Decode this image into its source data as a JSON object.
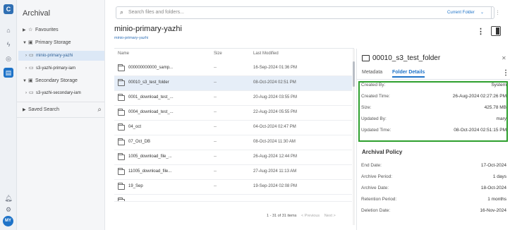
{
  "app": {
    "nav_title": "Archival",
    "avatar_initials": "MY"
  },
  "nav": {
    "favourites": "Favourites",
    "primary_storage": "Primary Storage",
    "primary_buckets": [
      "minio-primary-yazhi",
      "s3-yazhi-primary-iam"
    ],
    "secondary_storage": "Secondary Storage",
    "secondary_buckets": [
      "s3-yazhi-secondary-iam"
    ],
    "saved_search": "Saved Search"
  },
  "search": {
    "placeholder": "Search files and folders...",
    "scope": "Current Folder"
  },
  "bucket": {
    "title": "minio-primary-yazhi",
    "subtitle": "minio-primary-yazhi"
  },
  "table": {
    "columns": {
      "name": "Name",
      "size": "Size",
      "modified": "Last Modified"
    },
    "rows": [
      {
        "name": "000000000000_samp...",
        "size": "--",
        "modified": "16-Sep-2024 01:36 PM"
      },
      {
        "name": "00010_s3_test_folder",
        "size": "--",
        "modified": "08-Oct-2024 02:51 PM"
      },
      {
        "name": "0001_download_test_...",
        "size": "--",
        "modified": "20-Aug-2024 03:55 PM"
      },
      {
        "name": "0004_download_test_...",
        "size": "--",
        "modified": "22-Aug-2024 05:55 PM"
      },
      {
        "name": "04_oct",
        "size": "--",
        "modified": "04-Oct-2024 02:47 PM"
      },
      {
        "name": "07_Oct_DB",
        "size": "--",
        "modified": "08-Oct-2024 11:30 AM"
      },
      {
        "name": "1005_download_file_...",
        "size": "--",
        "modified": "26-Aug-2024 12:44 PM"
      },
      {
        "name": "11005_download_file...",
        "size": "--",
        "modified": "27-Aug-2024 11:13 AM"
      },
      {
        "name": "19_Sep",
        "size": "--",
        "modified": "19-Sep-2024 02:08 PM"
      },
      {
        "name": "",
        "size": "",
        "modified": ""
      }
    ],
    "pagination": {
      "summary": "1 - 31 of 31 items",
      "previous": "< Previous",
      "next": "Next >"
    }
  },
  "details": {
    "title": "00010_s3_test_folder",
    "tabs": [
      "Metadata",
      "Folder Details"
    ],
    "folder_details": [
      {
        "label": "Created By:",
        "value": "System"
      },
      {
        "label": "Created Time:",
        "value": "26-Aug-2024 02:27:26 PM"
      },
      {
        "label": "Size:",
        "value": "425.78 MB"
      },
      {
        "label": "Updated By:",
        "value": "mary"
      },
      {
        "label": "Updated Time:",
        "value": "08-Oct-2024 02:51:15 PM"
      }
    ],
    "archival_policy_title": "Archival Policy",
    "archival_policy": [
      {
        "label": "End Date:",
        "value": "17-Oct-2024"
      },
      {
        "label": "Archive Period:",
        "value": "1 days"
      },
      {
        "label": "Archive Date:",
        "value": "18-Oct-2024"
      },
      {
        "label": "Retention Period:",
        "value": "1 months"
      },
      {
        "label": "Deletion Date:",
        "value": "16-Nov-2024"
      }
    ]
  },
  "colors": {
    "accent": "#1e73c8",
    "highlight_box": "#2ea02e"
  }
}
